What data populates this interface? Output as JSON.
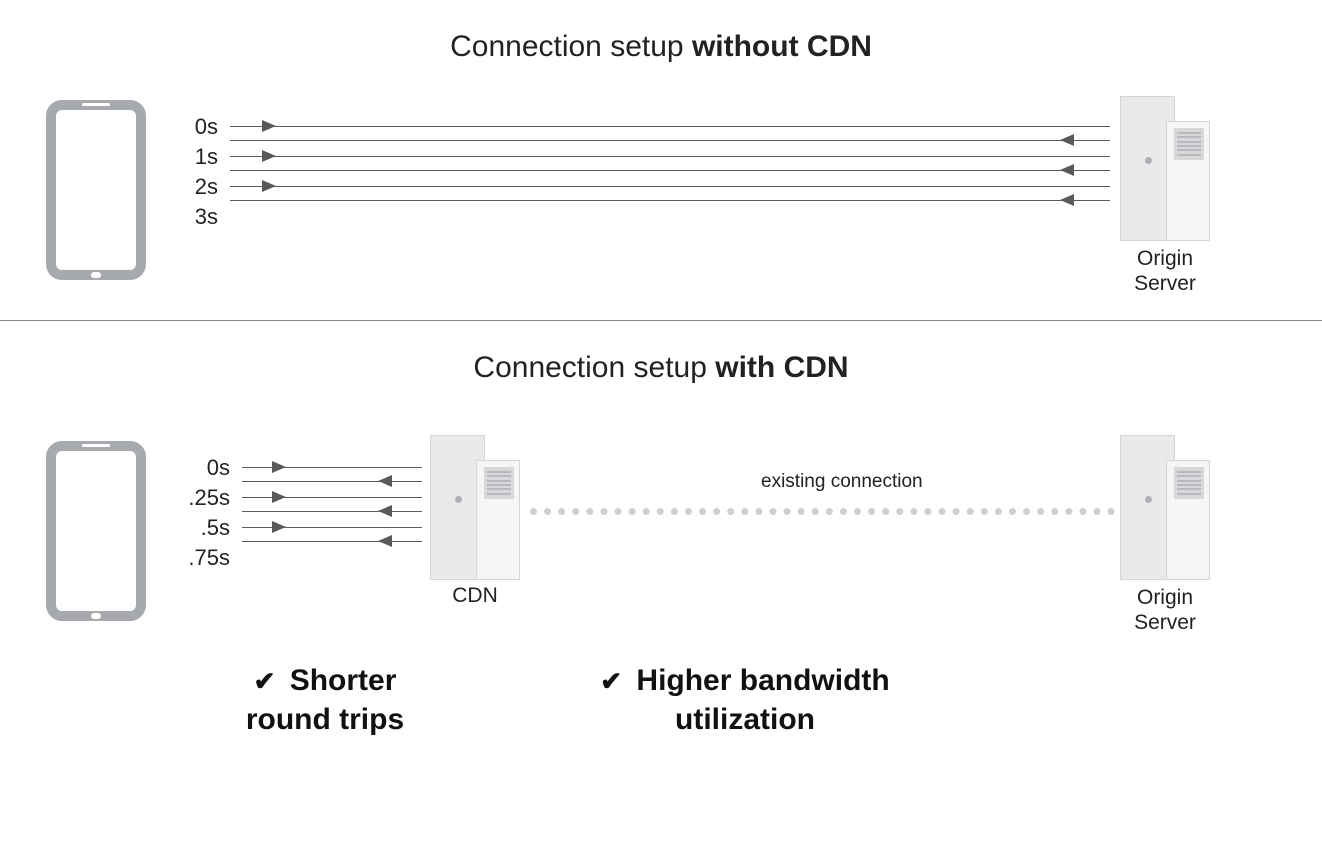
{
  "top": {
    "title_prefix": "Connection setup ",
    "title_bold": "without CDN",
    "timings": [
      "0s",
      "1s",
      "2s",
      "3s"
    ],
    "origin_label_line1": "Origin",
    "origin_label_line2": "Server"
  },
  "bottom": {
    "title_prefix": "Connection setup ",
    "title_bold": "with CDN",
    "timings": [
      "0s",
      ".25s",
      ".5s",
      ".75s"
    ],
    "cdn_label": "CDN",
    "origin_label_line1": "Origin",
    "origin_label_line2": "Server",
    "existing_connection": "existing connection",
    "benefit1_check": "✔",
    "benefit1_line1": " Shorter",
    "benefit1_line2": "round trips",
    "benefit2_check": "✔",
    "benefit2_line1": " Higher bandwidth",
    "benefit2_line2": "utilization"
  }
}
